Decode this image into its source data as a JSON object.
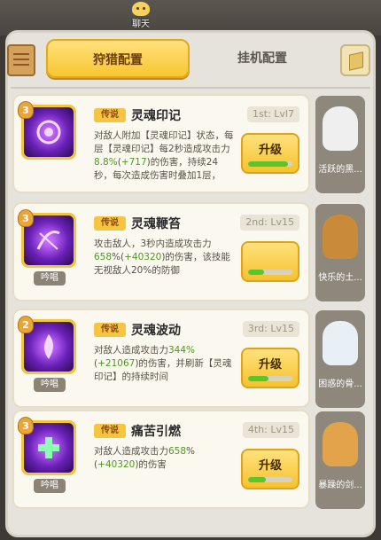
{
  "header": {
    "chat_label": "聊天"
  },
  "tabs": {
    "hunt": "狩猎配置",
    "idle": "挂机配置"
  },
  "skills": [
    {
      "rank": "3",
      "tag": "传说",
      "name": "灵魂印记",
      "level": "1st: Lvl7",
      "chant": "",
      "desc_parts": [
        {
          "t": "对敌人附加【灵魂印记】状态，每层【灵魂印记】每2秒造成攻击力"
        },
        {
          "t": "8.8%",
          "g": true
        },
        {
          "t": "("
        },
        {
          "t": "+717",
          "g": true
        },
        {
          "t": ")的伤害，持续24秒，每次造成伤害时叠加1层，"
        }
      ],
      "upgrade": "升级",
      "progress": 0.9,
      "icon_color": "#9b3cff"
    },
    {
      "rank": "3",
      "tag": "传说",
      "name": "灵魂鞭笞",
      "level": "2nd: Lv15",
      "chant": "吟唱",
      "desc_parts": [
        {
          "t": "攻击敌人，3秒内造成攻击力"
        },
        {
          "t": "658",
          "g": true
        },
        {
          "t": "%("
        },
        {
          "t": "+40320",
          "g": true
        },
        {
          "t": ")的伤害，该技能无视敌人20%的防御"
        }
      ],
      "upgrade": "",
      "progress": 0.35,
      "icon_color": "#7b2ac9"
    },
    {
      "rank": "2",
      "tag": "传说",
      "name": "灵魂波动",
      "level": "3rd: Lv15",
      "chant": "吟唱",
      "desc_parts": [
        {
          "t": "对敌人造成攻击力"
        },
        {
          "t": "344%",
          "g": true
        },
        {
          "t": "("
        },
        {
          "t": "+21067",
          "g": true
        },
        {
          "t": ")的伤害，并刷新【灵魂印记】的持续时间"
        }
      ],
      "upgrade": "升级",
      "progress": 0.45,
      "icon_color": "#8a34e0"
    },
    {
      "rank": "3",
      "tag": "传说",
      "name": "痛苦引燃",
      "level": "4th: Lv15",
      "chant": "吟唱",
      "desc_parts": [
        {
          "t": "对敌人造成攻击力"
        },
        {
          "t": "658",
          "g": true
        },
        {
          "t": "%("
        },
        {
          "t": "+40320",
          "g": true
        },
        {
          "t": ")的伤害"
        }
      ],
      "upgrade": "升级",
      "progress": 0.4,
      "icon_color": "#6d2bbd"
    }
  ],
  "companions": [
    {
      "name": "活跃的黑...",
      "color": "#efefef"
    },
    {
      "name": "快乐的土...",
      "color": "#c98b3a"
    },
    {
      "name": "困惑的骨...",
      "color": "#e8f0f5"
    },
    {
      "name": "暴躁的剑...",
      "color": "#e3a34b"
    }
  ]
}
